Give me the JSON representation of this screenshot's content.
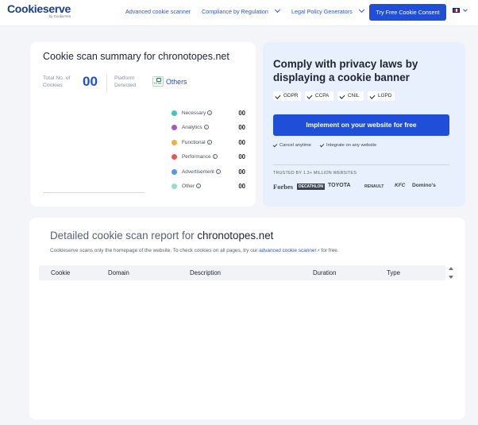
{
  "header": {
    "logo_text": "Cookieserve",
    "logo_sub": "by CookieYes",
    "nav": {
      "scanner": "Advanced cookie scanner",
      "compliance": "Compliance by Regulation",
      "legal": "Legal Policy Generators"
    },
    "cta": "Try Free Cookie Consent",
    "language_icon": "uk-flag-icon"
  },
  "summary": {
    "title": "Cookie scan summary for chronotopes.net",
    "total_label_1": "Total No. of",
    "total_label_2": "Cookies",
    "total_value": "00",
    "platform_label_1": "Platform",
    "platform_label_2": "Detected",
    "platform_badge": "HTML",
    "platform_value": "Others",
    "legend": [
      {
        "label": "Necessary",
        "count": "00",
        "color": "#3ec7c2"
      },
      {
        "label": "Analytics",
        "count": "00",
        "color": "#a855c8"
      },
      {
        "label": "Functional",
        "count": "00",
        "color": "#e8b341"
      },
      {
        "label": "Performance",
        "count": "00",
        "color": "#e25a4f"
      },
      {
        "label": "Advertisement",
        "count": "00",
        "color": "#4f9be0"
      },
      {
        "label": "Other",
        "count": "00",
        "color": "#8fe0cf"
      }
    ]
  },
  "comply": {
    "title": "Comply with privacy laws by displaying a cookie banner",
    "regulations": [
      "GDPR",
      "CCPA",
      "CNIL",
      "LGPD"
    ],
    "button": "Implement on your website for free",
    "features": [
      "Cancel anytime",
      "Integrate on any website"
    ],
    "trusted": "TRUSTED BY 1.3+ MILLION WEBSITES",
    "brands": [
      "Forbes",
      "DECATHLON",
      "TOYOTA",
      "RENAULT",
      "KFC",
      "Domino's"
    ]
  },
  "report": {
    "title_prefix": "Detailed cookie scan report for ",
    "title_domain": "chronotopes.net",
    "note_before": "Cookieserve scans only the homepage of the website. To check cookies on all pages, try our ",
    "note_link": "advanced cookie scanner",
    "note_after": " for free.",
    "columns": [
      "Cookie",
      "Domain",
      "Description",
      "Duration",
      "Type"
    ]
  }
}
